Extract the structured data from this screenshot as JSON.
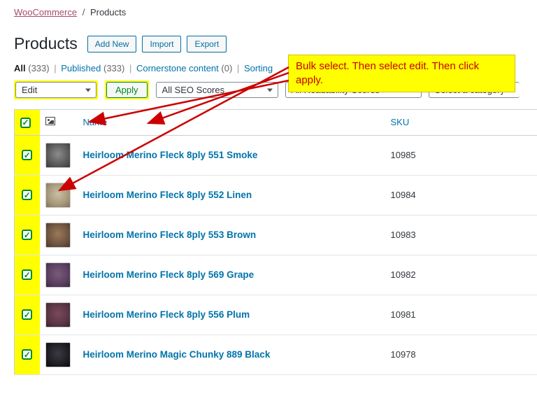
{
  "breadcrumb": {
    "parent": "WooCommerce",
    "current": "Products"
  },
  "page": {
    "title": "Products",
    "add_new": "Add New",
    "import": "Import",
    "export": "Export"
  },
  "subsubsub": {
    "all": "All",
    "all_count": "(333)",
    "published": "Published",
    "published_count": "(333)",
    "cornerstone": "Cornerstone content",
    "cornerstone_count": "(0)",
    "sorting": "Sorting"
  },
  "filters": {
    "bulk_action": "Edit",
    "apply": "Apply",
    "seo": "All SEO Scores",
    "readability": "All Readability Scores",
    "category": "Select a category"
  },
  "columns": {
    "name": "Name",
    "sku": "SKU"
  },
  "products": [
    {
      "name": "Heirloom Merino Fleck 8ply 551 Smoke",
      "sku": "10985",
      "cls": "smoke"
    },
    {
      "name": "Heirloom Merino Fleck 8ply 552 Linen",
      "sku": "10984",
      "cls": "linen"
    },
    {
      "name": "Heirloom Merino Fleck 8ply 553 Brown",
      "sku": "10983",
      "cls": "brown"
    },
    {
      "name": "Heirloom Merino Fleck 8ply 569 Grape",
      "sku": "10982",
      "cls": "grape"
    },
    {
      "name": "Heirloom Merino Fleck 8ply 556 Plum",
      "sku": "10981",
      "cls": "plum"
    },
    {
      "name": "Heirloom Merino Magic Chunky 889 Black",
      "sku": "10978",
      "cls": "black"
    }
  ],
  "annotation": {
    "text": "Bulk select. Then select edit. Then click apply."
  }
}
